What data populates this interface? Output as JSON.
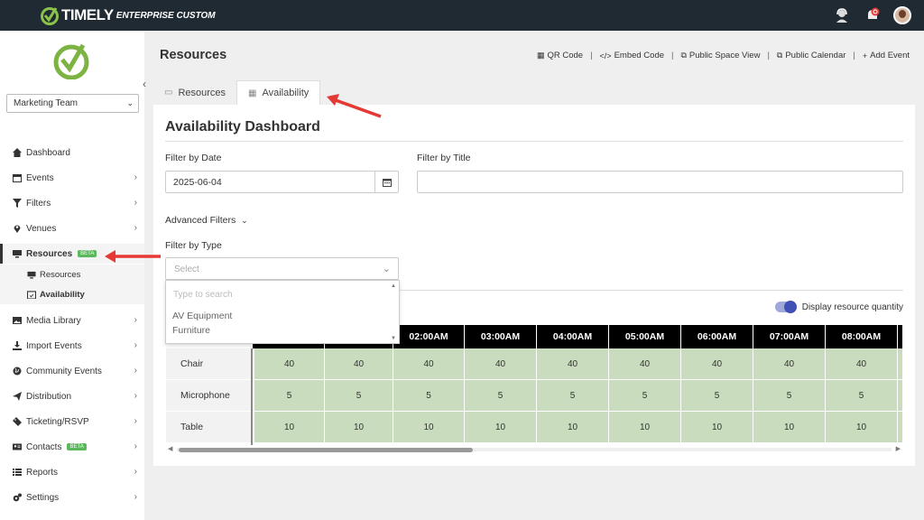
{
  "brand": {
    "name": "TIMELY",
    "edition": "ENTERPRISE CUSTOM"
  },
  "sidebar": {
    "team_select": "Marketing Team",
    "items": [
      {
        "label": "Dashboard",
        "icon": "home-icon",
        "arrow": false
      },
      {
        "label": "Events",
        "icon": "calendar-icon",
        "arrow": true
      },
      {
        "label": "Filters",
        "icon": "filter-icon",
        "arrow": true
      },
      {
        "label": "Venues",
        "icon": "map-pin-icon",
        "arrow": true
      },
      {
        "label": "Resources",
        "icon": "monitor-icon",
        "badge": "BETA",
        "active": true
      },
      {
        "label": "Media Library",
        "icon": "image-icon",
        "arrow": true
      },
      {
        "label": "Import Events",
        "icon": "download-icon",
        "arrow": true
      },
      {
        "label": "Community Events",
        "icon": "globe-icon",
        "arrow": true
      },
      {
        "label": "Distribution",
        "icon": "send-icon",
        "arrow": true
      },
      {
        "label": "Ticketing/RSVP",
        "icon": "ticket-icon",
        "arrow": true
      },
      {
        "label": "Contacts",
        "icon": "contact-card-icon",
        "badge": "BETA",
        "arrow": true
      },
      {
        "label": "Reports",
        "icon": "list-icon",
        "arrow": true
      },
      {
        "label": "Settings",
        "icon": "gears-icon",
        "arrow": true
      }
    ],
    "sub_items": [
      {
        "label": "Resources",
        "icon": "monitor-icon"
      },
      {
        "label": "Availability",
        "icon": "calendar-check-icon",
        "active": true
      }
    ]
  },
  "header": {
    "title": "Resources",
    "actions": [
      {
        "label": "QR Code",
        "icon": "qr-icon"
      },
      {
        "label": "Embed Code",
        "icon": "code-icon"
      },
      {
        "label": "Public Space View",
        "icon": "external-link-icon"
      },
      {
        "label": "Public Calendar",
        "icon": "external-link-icon"
      },
      {
        "label": "Add Event",
        "icon": "plus-icon"
      }
    ]
  },
  "tabs": [
    {
      "label": "Resources",
      "icon": "monitor-icon"
    },
    {
      "label": "Availability",
      "icon": "calendar-icon",
      "active": true
    }
  ],
  "panel": {
    "title": "Availability Dashboard",
    "filter_date_label": "Filter by Date",
    "filter_date_value": "2025-06-04",
    "filter_title_label": "Filter by Title",
    "filter_title_value": "",
    "advanced_filters": "Advanced Filters",
    "filter_type_label": "Filter by Type",
    "filter_type_placeholder": "Select",
    "dropdown": {
      "search_placeholder": "Type to search",
      "options": [
        "AV Equipment",
        "Furniture"
      ]
    },
    "toggle_label": "Display resource quantity",
    "toggle_on": true
  },
  "grid": {
    "hours": [
      "",
      "",
      "02:00AM",
      "03:00AM",
      "04:00AM",
      "05:00AM",
      "06:00AM",
      "07:00AM",
      "08:00AM",
      ""
    ],
    "rows": [
      {
        "name": "Chair",
        "values": [
          "40",
          "40",
          "40",
          "40",
          "40",
          "40",
          "40",
          "40",
          "40",
          ""
        ]
      },
      {
        "name": "Microphone",
        "values": [
          "5",
          "5",
          "5",
          "5",
          "5",
          "5",
          "5",
          "5",
          "5",
          ""
        ]
      },
      {
        "name": "Table",
        "values": [
          "10",
          "10",
          "10",
          "10",
          "10",
          "10",
          "10",
          "10",
          "10",
          ""
        ]
      }
    ]
  },
  "colors": {
    "topbar": "#1f2a33",
    "brand_green": "#7cb342",
    "cell_green": "#c9dcbd",
    "annotation_red": "#e53935",
    "toggle": "#3f51b5"
  }
}
